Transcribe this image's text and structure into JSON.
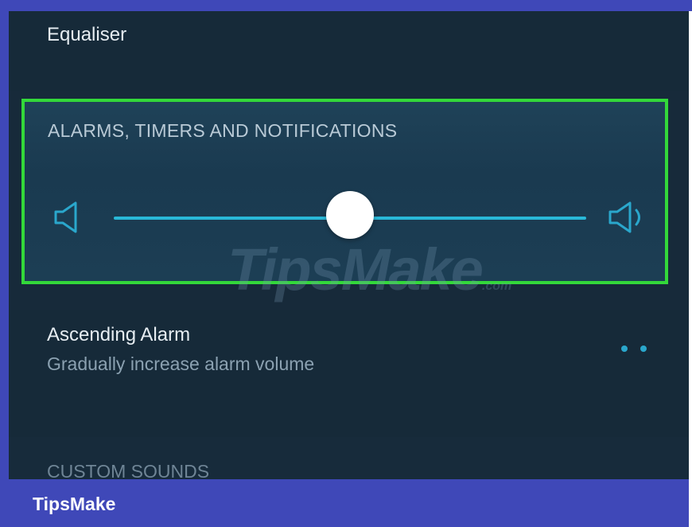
{
  "settings": {
    "equaliser_label": "Equaliser",
    "alarm_section": {
      "header": "ALARMS, TIMERS AND NOTIFICATIONS",
      "volume_level": 0.5,
      "low_icon": "volume-low-icon",
      "high_icon": "volume-high-icon"
    },
    "ascending_alarm": {
      "title": "Ascending Alarm",
      "subtitle": "Gradually increase alarm volume"
    },
    "custom_sounds_label": "CUSTOM SOUNDS"
  },
  "watermark": {
    "center_text": "TipsMake",
    "center_suffix": ".com",
    "brand_text": "TipsMake"
  },
  "colors": {
    "highlight_border": "#33d83a",
    "accent": "#29b8d8",
    "background": "#172a3a",
    "brand_bar": "#3f48b8"
  }
}
